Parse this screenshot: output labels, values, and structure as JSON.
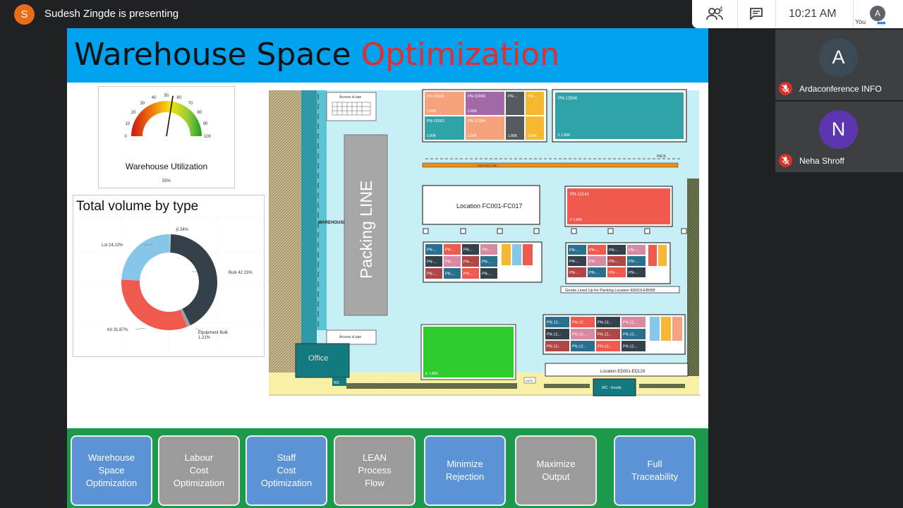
{
  "presenter": {
    "initial": "S",
    "text": "Sudesh Zingde is presenting"
  },
  "controls": {
    "people_icon": "people-icon",
    "people_count": "4",
    "chat_icon": "chat-icon",
    "time": "10:21 AM",
    "self_initial": "A",
    "self_label": "You",
    "more_icon": "more-icon"
  },
  "slide": {
    "title_main": "Warehouse Space ",
    "title_accent": "Optimization",
    "gauge": {
      "label": "Warehouse Utilization",
      "value_text": "55%",
      "value": 55,
      "ticks": [
        "0",
        "10",
        "20",
        "30",
        "40",
        "50",
        "60",
        "70",
        "80",
        "90",
        "100"
      ]
    },
    "donut": {
      "title": "Total volume by type",
      "segments": [
        {
          "name": "Bulk",
          "value_text": "42.15%",
          "color": "#35414a",
          "value": 42.15
        },
        {
          "name": "Equipment Bulk",
          "value_text": "1.21%",
          "color": "#9aa1a6",
          "value": 1.21
        },
        {
          "name": "Kit",
          "value_text": "31.87%",
          "color": "#f05a4e",
          "value": 31.87
        },
        {
          "name": "Lot",
          "value_text": "24.22%",
          "color": "#87c6e8",
          "value": 24.22
        },
        {
          "name": "",
          "value_text": "0.34%",
          "color": "#d0d0d0",
          "value": 0.34
        }
      ]
    },
    "floorplan": {
      "access_slope_top": "Access sLope",
      "access_slope_bottom": "Access sLope",
      "warehouse": "WAREHOUSE",
      "packing_line": "Packing LINE",
      "office": "Office",
      "wc_left": "WC",
      "wc_goods": "WC - Goods",
      "gate": "GATE",
      "pack": "PACK",
      "packing_line_strip": "PACKING LINE",
      "location_fc": "Location FC001-FC017",
      "goods_lined": "Goods Lined Up for Packing Location EB019-EB058",
      "location_ed": "Location ED001-ED129",
      "pn_top": [
        {
          "id": "PN-13036",
          "qty": "1.80K",
          "color": "#f5a27d"
        },
        {
          "id": "PN-12490",
          "qty": "1.80K",
          "color": "#a36aa8"
        },
        {
          "id": "PN-...",
          "qty": "",
          "color": "#555a5f"
        },
        {
          "id": "PN-...",
          "qty": "",
          "color": "#f6b830"
        },
        {
          "id": "PN-12662",
          "qty": "1.80K",
          "color": "#2ea3a8"
        },
        {
          "id": "PN-12394",
          "qty": "1.80K",
          "color": "#f5a27d"
        },
        {
          "id": "",
          "qty": "1.80K",
          "color": "#555a5f"
        },
        {
          "id": "",
          "qty": "1.80K",
          "color": "#f6b830"
        }
      ],
      "pn_12504": {
        "id": "PN-12504",
        "qty": "F 1.80K"
      },
      "pn_12141": {
        "id": "PN-12141",
        "qty": "F 1.80K"
      },
      "green_block": {
        "qty": "E 1.80K"
      },
      "cells_short": "PN-...",
      "cells_p": "P...",
      "cells_13": "PN-13...",
      "cells_12": "PN-12..."
    }
  },
  "buttons": [
    {
      "label": "Warehouse\nSpace\nOptimization",
      "style": "blue"
    },
    {
      "label": "Labour\nCost\nOptimization",
      "style": "gray"
    },
    {
      "label": "Staff\nCost\nOptimization",
      "style": "blue"
    },
    {
      "label": "LEAN\nProcess\nFlow",
      "style": "gray"
    },
    {
      "label": "Minimize\nRejection",
      "style": "blue"
    },
    {
      "label": "Maximize\nOutput",
      "style": "gray"
    },
    {
      "label": "Full\nTraceability",
      "style": "blue"
    }
  ],
  "participants": [
    {
      "initial": "A",
      "name": "Ardaconference INFO",
      "color": "#3c4a55",
      "mic_icon": "mic-off-icon"
    },
    {
      "initial": "N",
      "name": "Neha Shroff",
      "color": "#5e35b1",
      "mic_icon": "mic-off-icon"
    }
  ]
}
